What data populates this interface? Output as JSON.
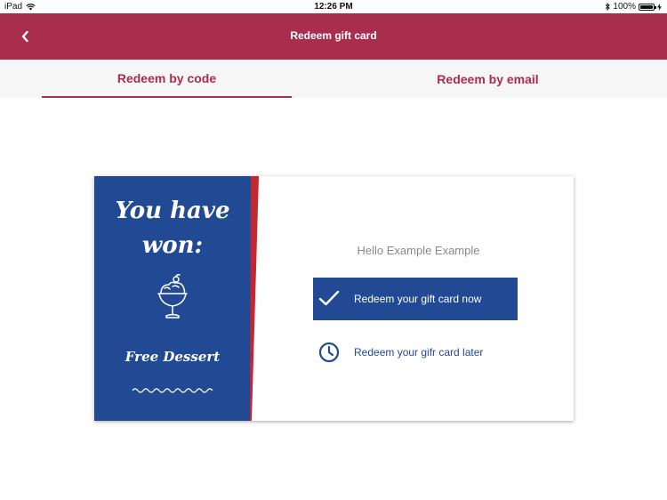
{
  "status": {
    "device": "iPad",
    "time": "12:26 PM",
    "battery": "100%",
    "battery_level": 1.0
  },
  "nav": {
    "title": "Redeem gift card",
    "back_icon": "chevron-left-icon"
  },
  "tabs": [
    {
      "label": "Redeem by code",
      "selected": true
    },
    {
      "label": "Redeem by email",
      "selected": false
    }
  ],
  "card": {
    "heading": "You have won:",
    "prize": "Free Dessert",
    "prize_icon": "ice-cream-sundae-icon",
    "greeting": "Hello Example Example",
    "redeem_now": "Redeem your gift card now",
    "redeem_later": "Redeem your gifr card later"
  },
  "colors": {
    "brand": "#a92e4e",
    "card_blue": "#224a94",
    "stripe_red": "#c3282f"
  }
}
